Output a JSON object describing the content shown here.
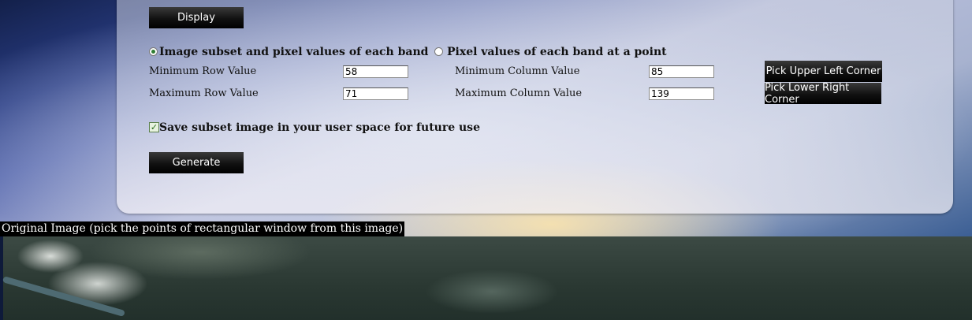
{
  "buttons": {
    "display": "Display",
    "generate": "Generate",
    "pick_upper_left": "Pick Upper Left Corner",
    "pick_lower_right": "Pick Lower Right Corner"
  },
  "modes": {
    "subset_label": "Image subset and pixel values of each band",
    "subset_selected": true,
    "point_label": "Pixel values of each band at a point",
    "point_selected": false
  },
  "fields": {
    "min_row_label": "Minimum Row Value",
    "min_row_value": "58",
    "max_row_label": "Maximum Row Value",
    "max_row_value": "71",
    "min_col_label": "Minimum Column Value",
    "min_col_value": "85",
    "max_col_label": "Maximum Column Value",
    "max_col_value": "139"
  },
  "save_option": {
    "label": "Save subset image in your user space for future use",
    "checked": true
  },
  "original_image": {
    "caption": "Original Image (pick the points of rectangular window from this image)"
  },
  "colors": {
    "button_bg": "#000000",
    "radio_dot": "#2e7d32",
    "checkbox_mark": "#2b6e1e"
  }
}
